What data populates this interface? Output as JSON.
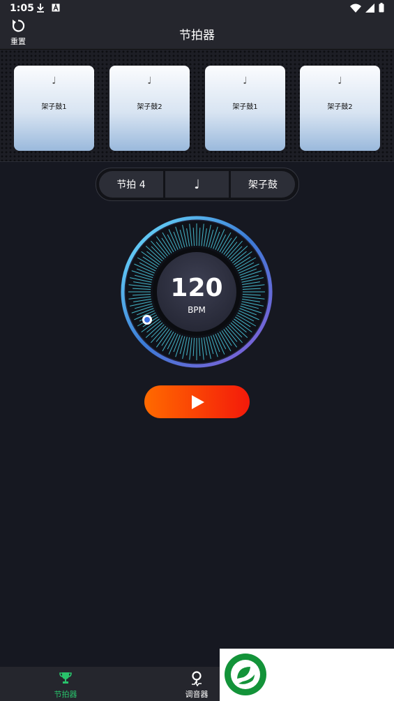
{
  "status_bar": {
    "time": "1:05",
    "icons_left": [
      "download-icon",
      "font-a-icon"
    ],
    "icons_right": [
      "wifi-icon",
      "signal-icon",
      "battery-icon"
    ]
  },
  "app_bar": {
    "reset_label": "重置",
    "title": "节拍器"
  },
  "pads": [
    {
      "note": "♩",
      "label": "架子鼓1"
    },
    {
      "note": "♩",
      "label": "架子鼓2"
    },
    {
      "note": "♩",
      "label": "架子鼓1"
    },
    {
      "note": "♩",
      "label": "架子鼓2"
    }
  ],
  "segments": {
    "beat": "节拍 4",
    "note": "♩",
    "sound": "架子鼓"
  },
  "dial": {
    "bpm": "120",
    "unit": "BPM"
  },
  "play": {
    "icon": "play-icon"
  },
  "bottom_nav": [
    {
      "label": "节拍器",
      "icon": "trophy-icon",
      "active": true
    },
    {
      "label": "调音器",
      "icon": "tuner-pin-icon",
      "active": false
    }
  ],
  "colors": {
    "accent_green": "#29c26b",
    "play_start": "#ff6a00",
    "play_end": "#f41a0a",
    "dial_glow": "#4fd3e8"
  }
}
